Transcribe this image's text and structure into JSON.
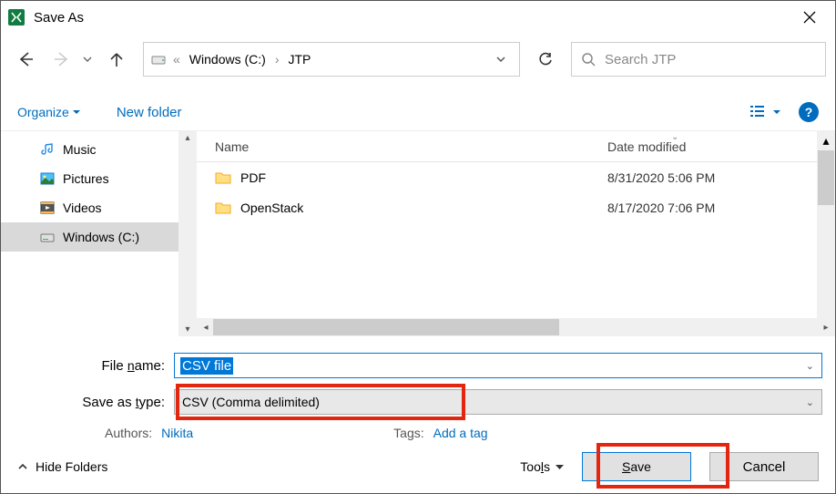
{
  "window": {
    "title": "Save As"
  },
  "nav": {
    "path_segments": [
      "Windows (C:)",
      "JTP"
    ],
    "search_placeholder": "Search JTP"
  },
  "toolbar": {
    "organize": "Organize",
    "new_folder": "New folder"
  },
  "sidebar": {
    "items": [
      {
        "label": "Music",
        "icon": "music-icon"
      },
      {
        "label": "Pictures",
        "icon": "pictures-icon"
      },
      {
        "label": "Videos",
        "icon": "videos-icon"
      },
      {
        "label": "Windows (C:)",
        "icon": "drive-icon",
        "active": true
      }
    ]
  },
  "filelist": {
    "columns": {
      "name": "Name",
      "date": "Date modified"
    },
    "rows": [
      {
        "name": "PDF",
        "date": "8/31/2020 5:06 PM"
      },
      {
        "name": "OpenStack",
        "date": "8/17/2020 7:06 PM"
      }
    ]
  },
  "form": {
    "filename_label": "File name:",
    "filename_value": "CSV file",
    "savetype_label": "Save as type:",
    "savetype_value": "CSV (Comma delimited)",
    "authors_label": "Authors:",
    "authors_value": "Nikita",
    "tags_label": "Tags:",
    "tags_value": "Add a tag"
  },
  "footer": {
    "hide_folders": "Hide Folders",
    "tools": "Tools",
    "save": "Save",
    "cancel": "Cancel"
  }
}
